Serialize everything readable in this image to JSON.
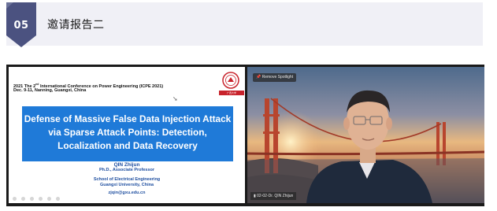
{
  "section": {
    "number": "05",
    "title": "邀请报告二",
    "badge_color": "#4b5280"
  },
  "slide": {
    "conference_line1_pre": "2021 The 2",
    "conference_line1_sup": "nd",
    "conference_line1_post": " International Conference on Power Engineering (ICPE 2021)",
    "conference_line2": "Dec. 9-11, Nanning, Guangxi, China",
    "title": "Defense of Massive False Data Injection Attack via Sparse Attack Points: Detection, Localization and Data Recovery",
    "presenter_name": "QIN Zhijun",
    "presenter_title": "Ph.D., Associate Professor",
    "presenter_school": "School of Electrical Engineering",
    "presenter_university": "Guangxi University, China",
    "presenter_email": "zjqin@gxu.edu.cn",
    "logo_text": "广西大学",
    "title_box_color": "#1f7ad8"
  },
  "video": {
    "spotlight_label": "Remove Spotlight",
    "participant_label": "02-02-Dr. QIN Zhijun"
  }
}
